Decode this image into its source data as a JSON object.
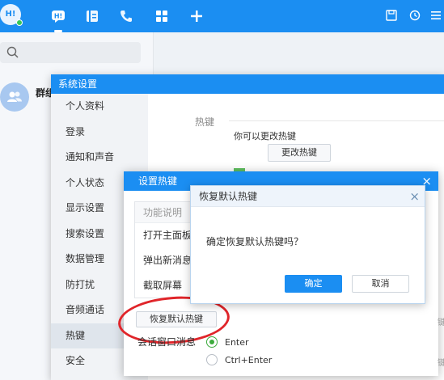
{
  "topbar": {
    "avatar_text": "H!",
    "nav": [
      "chat-icon",
      "contacts-icon",
      "phone-icon",
      "apps-icon",
      "add-icon"
    ],
    "right_icons": [
      "save-icon",
      "history-icon",
      "more-icon"
    ],
    "color": "#1b8ef2"
  },
  "leftpane": {
    "conversation_name": "群组"
  },
  "settings": {
    "title": "系统设置",
    "nav_items": [
      "个人资料",
      "登录",
      "通知和声音",
      "个人状态",
      "显示设置",
      "搜索设置",
      "数据管理",
      "防打扰",
      "音频通话",
      "热键",
      "安全"
    ],
    "selected_index": 9,
    "section_title": "热键",
    "hint": "你可以更改热键",
    "change_button": "更改热键"
  },
  "hotkey_dialog": {
    "title": "设置热键",
    "close": "×",
    "column_header": "功能说明",
    "rows": [
      "打开主面板",
      "弹出新消息",
      "截取屏幕"
    ],
    "restore_button": "恢复默认热键",
    "session_label": "会话窗口消息",
    "options": [
      "Enter",
      "Ctrl+Enter"
    ],
    "selected_option": 0,
    "side_fragments": [
      "键",
      "键"
    ]
  },
  "confirm_dialog": {
    "title": "恢复默认热键",
    "close": "×",
    "message": "确定恢复默认热键吗？",
    "ok": "确定",
    "cancel": "取消"
  },
  "colors": {
    "accent": "#1b8ef2",
    "highlight_ring": "#e0252a",
    "radio_on": "#3cab3c"
  }
}
